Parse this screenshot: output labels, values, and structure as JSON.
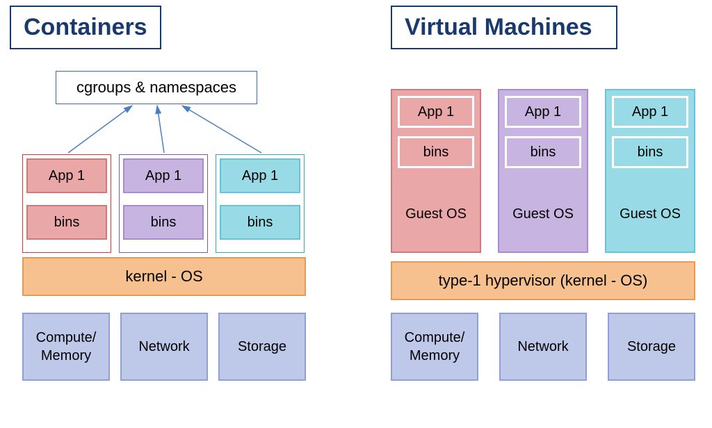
{
  "left": {
    "title": "Containers",
    "cgroups": "cgroups & namespaces",
    "containers": [
      {
        "app": "App 1",
        "bins": "bins"
      },
      {
        "app": "App 1",
        "bins": "bins"
      },
      {
        "app": "App 1",
        "bins": "bins"
      }
    ],
    "kernel": "kernel - OS",
    "hardware": [
      "Compute/ Memory",
      "Network",
      "Storage"
    ]
  },
  "right": {
    "title": "Virtual Machines",
    "vms": [
      {
        "app": "App 1",
        "bins": "bins",
        "guest": "Guest OS"
      },
      {
        "app": "App 1",
        "bins": "bins",
        "guest": "Guest OS"
      },
      {
        "app": "App 1",
        "bins": "bins",
        "guest": "Guest OS"
      }
    ],
    "hypervisor": "type-1 hypervisor (kernel - OS)",
    "hardware": [
      "Compute/ Memory",
      "Network",
      "Storage"
    ]
  }
}
